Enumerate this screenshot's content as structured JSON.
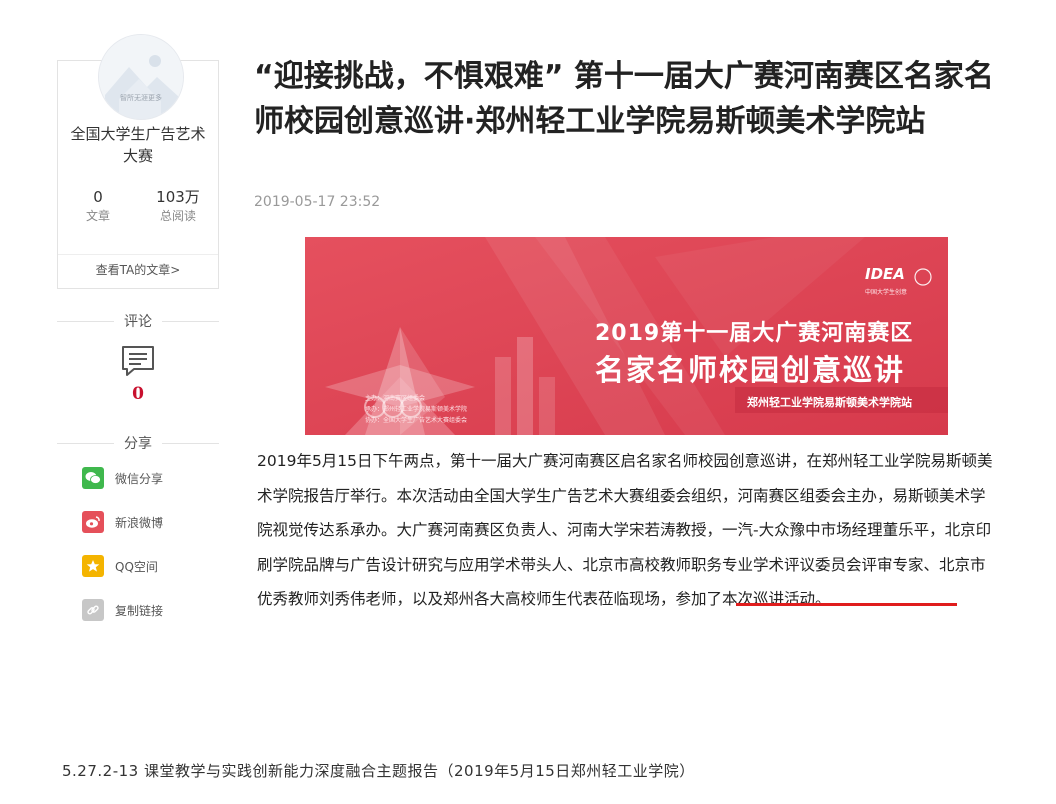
{
  "sidebar": {
    "avatar_caption": "智所无涯更多",
    "author_name": "全国大学生广告艺术大赛",
    "stats": [
      {
        "num": "0",
        "label": "文章"
      },
      {
        "num": "103万",
        "label": "总阅读"
      }
    ],
    "view_articles": "查看TA的文章>",
    "comment_heading": "评论",
    "comment_count": "0",
    "share_heading": "分享",
    "share_items": [
      {
        "label": "微信分享",
        "icon": "wechat-icon",
        "color": "#3fb84d"
      },
      {
        "label": "新浪微博",
        "icon": "weibo-icon",
        "color": "#e5505a"
      },
      {
        "label": "QQ空间",
        "icon": "qzone-icon",
        "color": "#f4b400"
      },
      {
        "label": "复制链接",
        "icon": "link-icon",
        "color": "#c7c7c7"
      }
    ]
  },
  "article": {
    "title": "“迎接挑战，不惧艰难” 第十一届大广赛河南赛区名家名师校园创意巡讲·郑州轻工业学院易斯顿美术学院站",
    "date": "2019-05-17 23:52",
    "banner": {
      "logo": "IDEA",
      "logo_caption": "中国大学生创意",
      "line1": "2019第十一届大广赛河南赛区",
      "line2": "名家名师校园创意巡讲",
      "subtitle": "郑州轻工业学院易斯顿美术学院站",
      "small_lines": [
        "主办：河南赛区组委会",
        "承办：郑州轻工业学院易斯顿美术学院",
        "协办：全国大学生广告艺术大赛组委会"
      ],
      "colors": {
        "bg": "#e04a5a",
        "accent": "#f07a86"
      }
    },
    "body_before": "2019年5月15日下午两点，第十一届大广赛河南赛区启名家名师校园创意巡讲，在郑州轻工业学院易斯顿美术学院报告厅举行。本次活动由全国大学生广告艺术大赛组委会组织，河南赛区组委会主办，易斯顿美术学院视觉传达系承办。大广赛河南赛区负责人、河南大学宋若涛教授，一汽-大众豫中市场经理董乐平，北京印刷学院品牌与广告设计研究与应用学术带头人、北京市高校教师职务专业学术评议委员会评审专家、",
    "body_highlight": "北京市优秀教师刘秀伟老师",
    "body_after": "，以及郑州各大高校师生代表莅临现场，参加了本次巡讲活动。",
    "highlight_color": "#e01d1d"
  },
  "caption": "5.27.2-13 课堂教学与实践创新能力深度融合主题报告（2019年5月15日郑州轻工业学院）"
}
